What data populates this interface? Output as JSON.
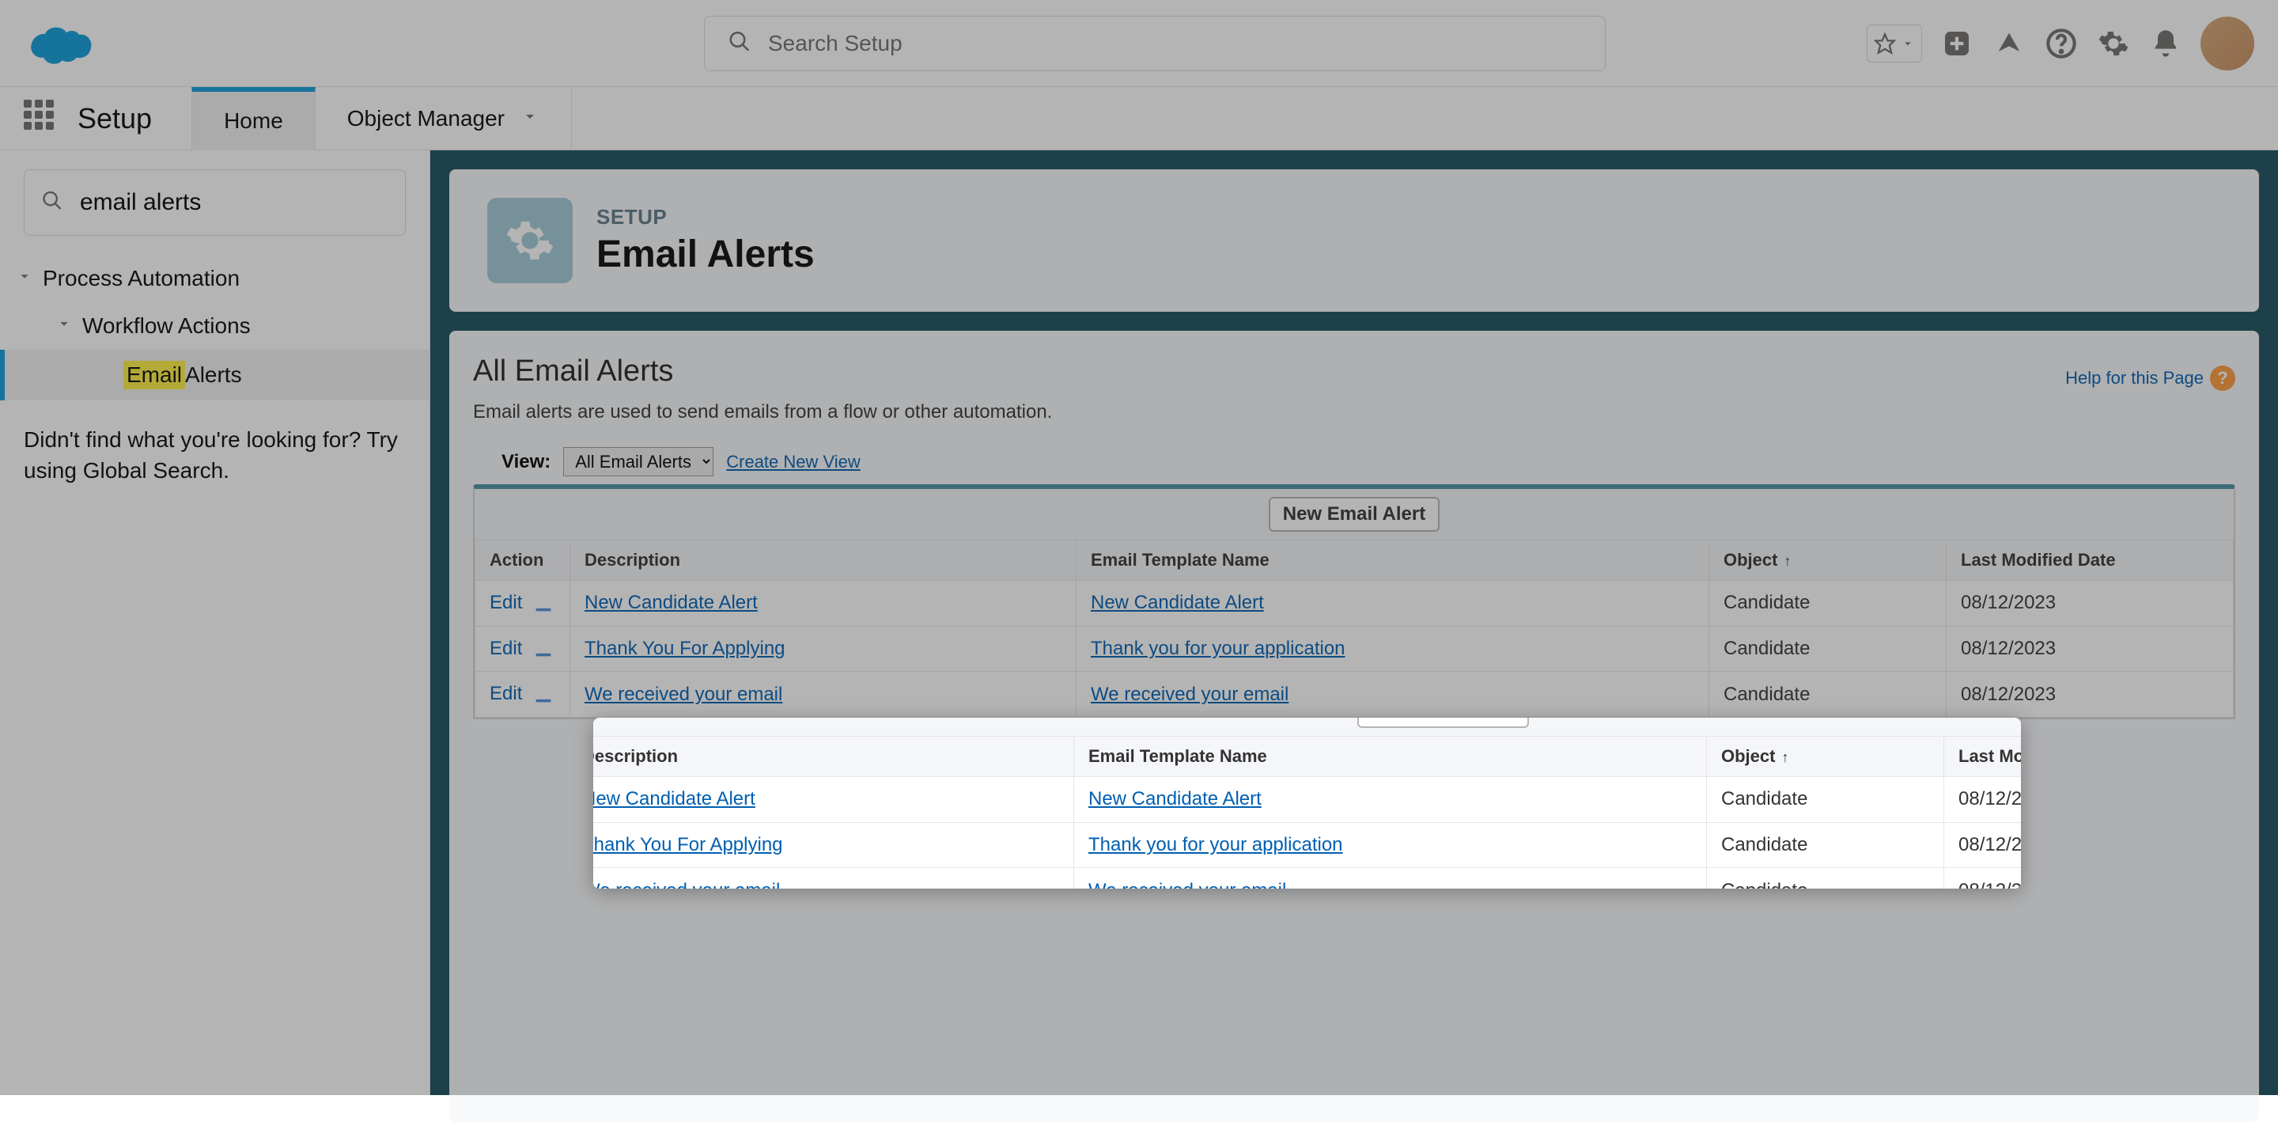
{
  "header": {
    "search_placeholder": "Search Setup"
  },
  "nav": {
    "app_title": "Setup",
    "tabs": [
      "Home",
      "Object Manager"
    ]
  },
  "sidebar": {
    "search_value": "email alerts",
    "tree": {
      "l1": "Process Automation",
      "l2": "Workflow Actions",
      "l3_prefix": "Email",
      "l3_suffix": " Alerts"
    },
    "hint": "Didn't find what you're looking for? Try using Global Search."
  },
  "page_header": {
    "eyebrow": "SETUP",
    "title": "Email Alerts"
  },
  "content": {
    "section_title": "All Email Alerts",
    "section_desc": "Email alerts are used to send emails from a flow or other automation.",
    "help_link": "Help for this Page",
    "view_label": "View:",
    "view_value": "All Email Alerts",
    "create_view": "Create New View",
    "new_btn": "New Email Alert"
  },
  "table": {
    "columns": [
      "Action",
      "Description",
      "Email Template Name",
      "Object",
      "Last Modified Date"
    ],
    "rows": [
      {
        "action": "Edit",
        "description": "New Candidate Alert",
        "template": "New Candidate Alert",
        "object": "Candidate",
        "date": "08/12/2023"
      },
      {
        "action": "Edit",
        "description": "Thank You For Applying",
        "template": "Thank you for your application",
        "object": "Candidate",
        "date": "08/12/2023"
      },
      {
        "action": "Edit",
        "description": "We received your email",
        "template": "We received your email",
        "object": "Candidate",
        "date": "08/12/2023"
      }
    ]
  }
}
